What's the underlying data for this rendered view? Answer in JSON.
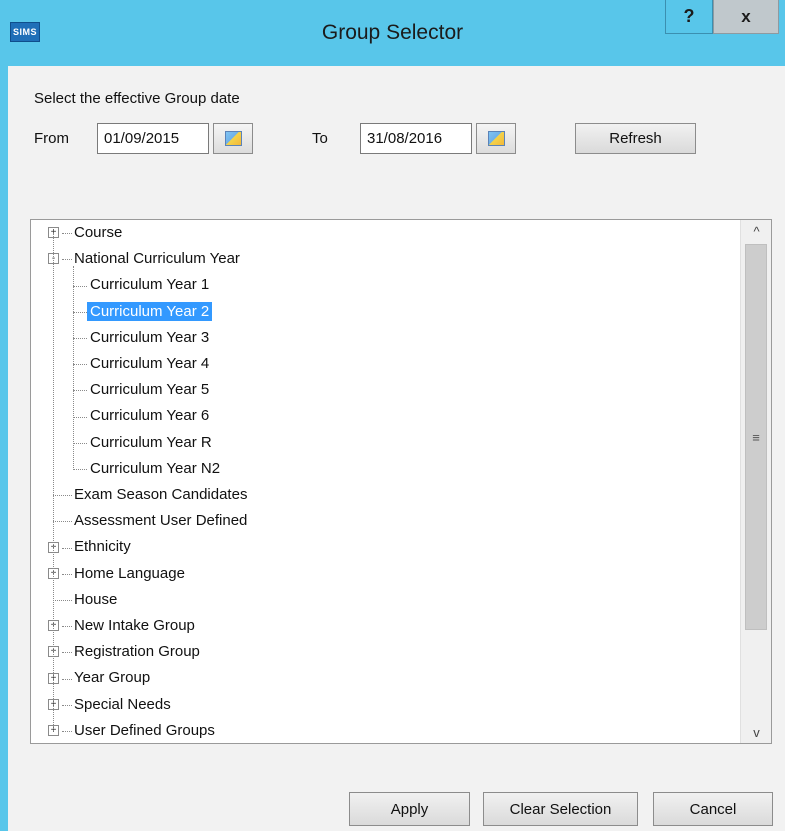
{
  "window": {
    "app_icon_text": "SIMS",
    "title": "Group Selector",
    "help_label": "?",
    "close_label": "x"
  },
  "dates": {
    "prompt": "Select the effective Group date",
    "from_label": "From",
    "from_value": "01/09/2015",
    "to_label": "To",
    "to_value": "31/08/2016",
    "refresh_label": "Refresh"
  },
  "tree": {
    "nodes": [
      {
        "label": "Course",
        "expander": "+"
      },
      {
        "label": "National Curriculum Year",
        "expander": "-"
      },
      {
        "label": "Curriculum Year  1"
      },
      {
        "label": "Curriculum Year  2",
        "selected": true
      },
      {
        "label": "Curriculum Year  3"
      },
      {
        "label": "Curriculum Year  4"
      },
      {
        "label": "Curriculum Year  5"
      },
      {
        "label": "Curriculum Year  6"
      },
      {
        "label": "Curriculum Year  R"
      },
      {
        "label": "Curriculum Year N2"
      },
      {
        "label": "Exam Season Candidates"
      },
      {
        "label": "Assessment User Defined"
      },
      {
        "label": "Ethnicity",
        "expander": "+"
      },
      {
        "label": "Home Language",
        "expander": "+"
      },
      {
        "label": "House"
      },
      {
        "label": "New Intake Group",
        "expander": "+"
      },
      {
        "label": "Registration Group",
        "expander": "+"
      },
      {
        "label": "Year Group",
        "expander": "+"
      },
      {
        "label": "Special Needs",
        "expander": "+"
      },
      {
        "label": "User Defined Groups",
        "expander": "+"
      }
    ],
    "scroll_up_glyph": "^",
    "scroll_down_glyph": "v",
    "scroll_grip_glyph": "≡"
  },
  "footer": {
    "apply_label": "Apply",
    "clear_label": "Clear Selection",
    "cancel_label": "Cancel"
  }
}
